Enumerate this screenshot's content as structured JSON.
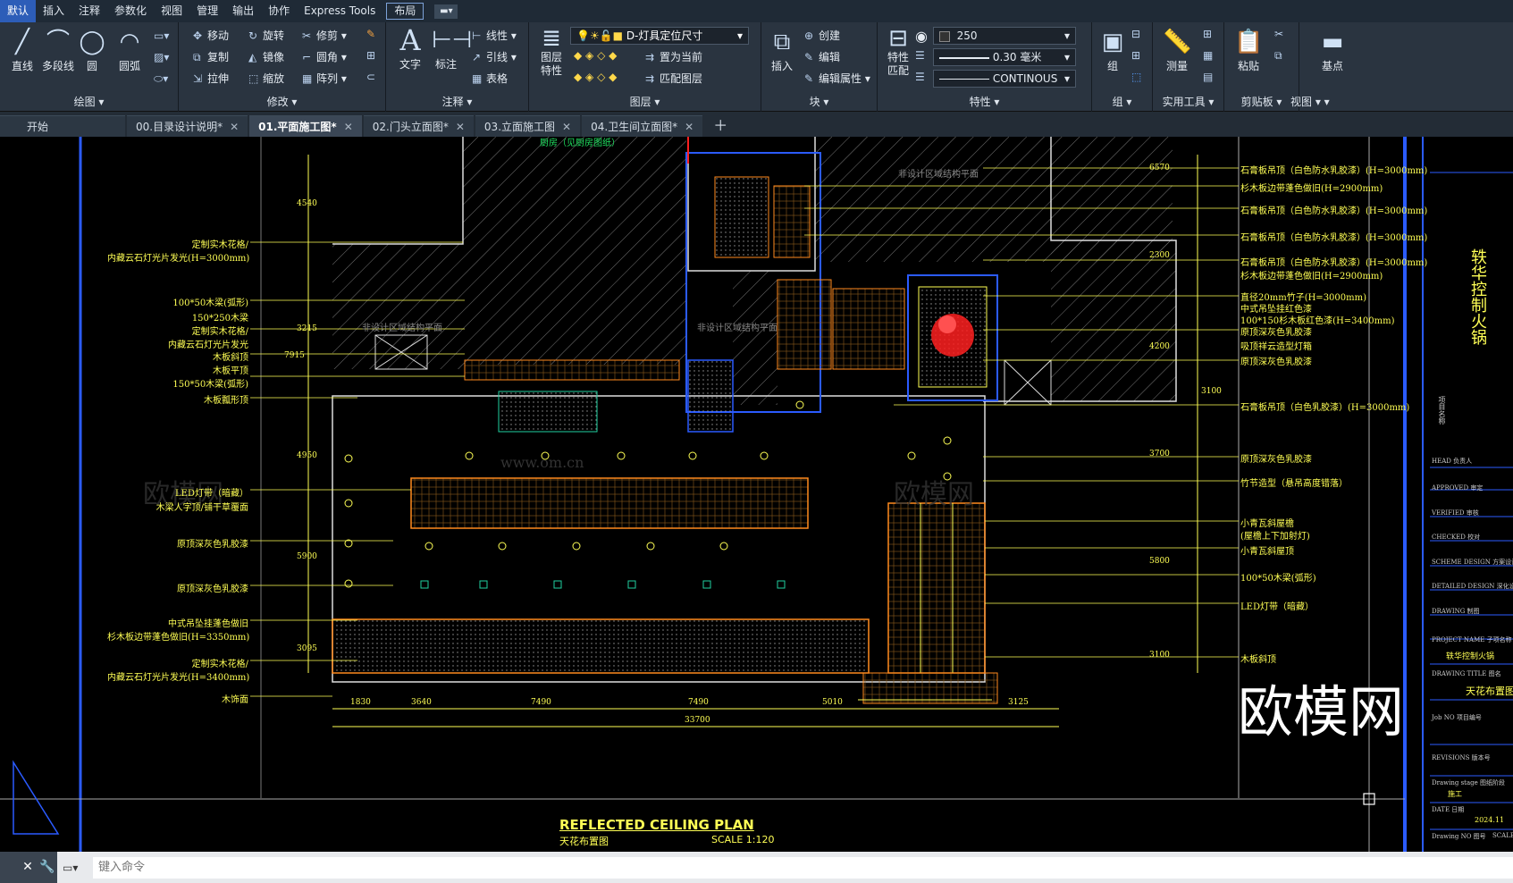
{
  "menubar": {
    "items": [
      "默认",
      "插入",
      "注释",
      "参数化",
      "视图",
      "管理",
      "输出",
      "协作",
      "Express Tools",
      "布局"
    ]
  },
  "ribbon": {
    "draw": {
      "title": "绘图",
      "line": "直线",
      "polyline": "多段线",
      "circle": "圆",
      "arc": "圆弧"
    },
    "modify": {
      "title": "修改",
      "move": "移动",
      "rotate": "旋转",
      "trim": "修剪",
      "copy": "复制",
      "mirror": "镜像",
      "fillet": "圆角",
      "stretch": "拉伸",
      "scale": "缩放",
      "array": "阵列"
    },
    "annotation": {
      "title": "注释",
      "text": "文字",
      "dimension": "标注",
      "linear": "线性",
      "leader": "引线",
      "table": "表格"
    },
    "layers": {
      "title": "图层",
      "props": "图层\n特性",
      "layer_name": "D-灯具定位尺寸",
      "set_current": "置为当前",
      "match": "匹配图层"
    },
    "block": {
      "title": "块",
      "insert": "插入",
      "create": "创建",
      "edit": "编辑",
      "edit_attr": "编辑属性"
    },
    "properties": {
      "title": "特性",
      "match": "特性\n匹配",
      "color": "250",
      "lineweight": "0.30 毫米",
      "linetype": "CONTINOUS"
    },
    "groups": {
      "title": "组",
      "group": "组"
    },
    "utilities": {
      "title": "实用工具",
      "measure": "测量"
    },
    "clipboard": {
      "title": "剪贴板",
      "paste": "粘贴"
    },
    "view": {
      "title": "视图",
      "base": "基点"
    }
  },
  "tabs": [
    {
      "label": "开始",
      "active": false,
      "closable": false
    },
    {
      "label": "00.目录设计说明*",
      "active": false,
      "closable": true
    },
    {
      "label": "01.平面施工图*",
      "active": true,
      "closable": true
    },
    {
      "label": "02.门头立面图*",
      "active": false,
      "closable": true
    },
    {
      "label": "03.立面施工图",
      "active": false,
      "closable": true
    },
    {
      "label": "04.卫生间立面图*",
      "active": false,
      "closable": true
    }
  ],
  "drawing": {
    "title": "REFLECTED CEILING PLAN",
    "subtitle": "天花布置图",
    "scale": "SCALE  1:120",
    "watermark": "欧模网",
    "watermark_url": "www.om.cn",
    "left_labels": [
      "定制实木花格/",
      "内藏云石灯光片发光(H=3000mm)",
      "100*50木梁(弧形)",
      "150*250木梁",
      "定制实木花格/",
      "内藏云石灯光片发光",
      "木板斜顶",
      "木板平顶",
      "150*50木梁(弧形)",
      "木板瓢形顶",
      "LED灯带（暗藏）",
      "木梁人字顶/铺干草覆面",
      "原顶深灰色乳胶漆",
      "原顶深灰色乳胶漆",
      "中式吊坠挂蓬色做旧",
      "杉木板边带蓬色做旧(H=3350mm)",
      "定制实木花格/",
      "内藏云石灯光片发光(H=3400mm)",
      "木饰面"
    ],
    "right_labels": [
      "石膏板吊顶（白色防水乳胶漆）(H=3000mm)",
      "杉木板边带蓬色做旧(H=2900mm)",
      "石膏板吊顶（白色防水乳胶漆）(H=3000mm)",
      "石膏板吊顶（白色防水乳胶漆）(H=3000mm)",
      "石膏板吊顶（白色防水乳胶漆）(H=3000mm)",
      "杉木板边带蓬色做旧(H=2900mm)",
      "直径20mm竹子(H=3000mm)",
      "中式吊坠挂红色漆",
      "100*150杉木板红色漆(H=3400mm)",
      "原顶深灰色乳胶漆",
      "吸顶祥云造型灯箱",
      "原顶深灰色乳胶漆",
      "石膏板吊顶（白色乳胶漆）(H=3000mm)",
      "原顶深灰色乳胶漆",
      "竹节造型（悬吊高度错落）",
      "小青瓦斜屋檐",
      "(屋檐上下加射灯)",
      "小青瓦斜屋顶",
      "100*50木梁(弧形)",
      "LED灯带（暗藏）",
      "木板斜顶"
    ],
    "dims_bottom": [
      "1830",
      "3640",
      "7490",
      "7490",
      "5010",
      "3125"
    ],
    "dim_total": "33700",
    "dims_right": [
      "6570",
      "2300",
      "4200",
      "3100",
      "3700",
      "5800",
      "3100"
    ],
    "dims_left": [
      "4540",
      "7915",
      "3215",
      "4950",
      "5900",
      "3095"
    ],
    "top_notes": [
      "厨房（见厨房图纸）",
      "非设计区域结构平面"
    ],
    "mid_notes": [
      "非设计区域结构平面",
      "非设计区域结构平面"
    ]
  },
  "titleblock": {
    "project_label": "PROJECT NAME 子项名称",
    "project_value": "轶华控制火锅",
    "drawing_title_label": "DRAWING TITLE 图名",
    "drawing_title_value": "天花布置图",
    "job_no": "Job NO 项目编号",
    "revisions": "REVISIONS 版本号",
    "stage_label": "Drawing stage 图纸阶段",
    "stage_value": "施工",
    "date_label": "DATE 日期",
    "date_value": "2024.11",
    "drawing_no": "Drawing NO 图号",
    "scale_label": "SCALE",
    "roles": [
      "HEAD 负责人",
      "APPROVED 审定",
      "VERIFIED 审核",
      "CHECKED 校对",
      "SCHEME DESIGN 方案设计",
      "DETAILED DESIGN 深化设计",
      "DRAWING 制图"
    ],
    "vertical_title": "轶华控制火锅",
    "vertical_name": "项目名称"
  },
  "cmdline": {
    "placeholder": "键入命令"
  },
  "colors": {
    "menubar": "#1f2a36",
    "ribbon": "#2a3440",
    "accent": "#2d5db8",
    "cad_yellow": "#ffff55",
    "cad_orange": "#ff8a1e",
    "cad_blue": "#2b5bff",
    "cad_white": "#e6e6e6",
    "cad_red": "#ff2020"
  }
}
